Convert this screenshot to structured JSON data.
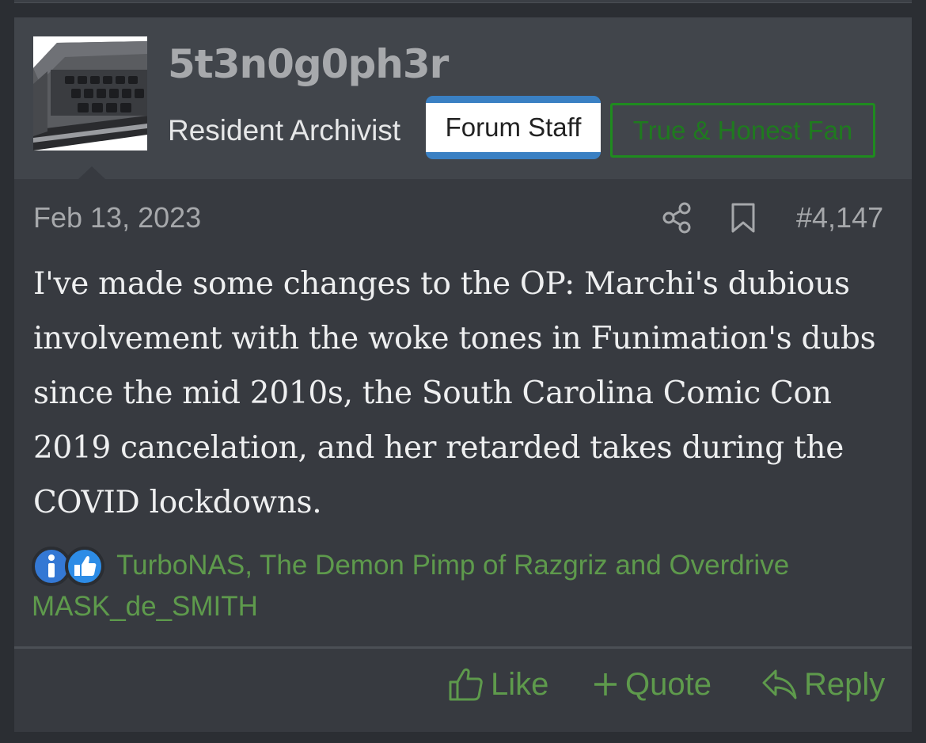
{
  "post": {
    "author": {
      "username": "5t3n0g0ph3r",
      "title": "Resident Archivist",
      "badges": {
        "staff": "Forum Staff",
        "fan": "True & Honest Fan"
      }
    },
    "date": "Feb 13, 2023",
    "number": "#4,147",
    "body": "I've made some changes to the OP: Marchi's dubious involvement with the woke tones in Funimation's dubs since the mid 2010s, the South Carolina Comic Con 2019 cancelation, and her retarded takes during the COVID lockdowns.",
    "reactions": {
      "icons": [
        "info-icon",
        "thumbs-up-icon"
      ],
      "users": "TurboNAS, The Demon Pimp of Razgriz and Overdrive MASK_de_SMITH"
    },
    "actions": {
      "like": "Like",
      "quote": "Quote",
      "reply": "Reply"
    }
  },
  "colors": {
    "page_bg": "#2b2e33",
    "post_bg": "#373a40",
    "header_bg": "#41454b",
    "accent_green": "#5e9a4c",
    "staff_badge_blue": "#3a80c3",
    "fan_badge_green": "#1f8b1f"
  }
}
